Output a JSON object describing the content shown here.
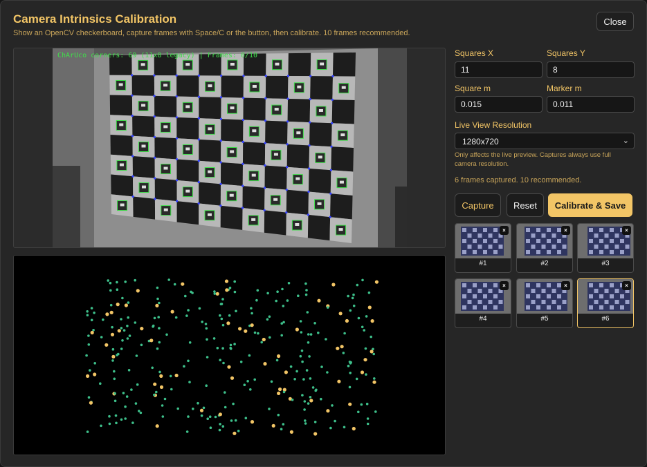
{
  "dialog": {
    "title": "Camera Intrinsics Calibration",
    "subtitle": "Show an OpenCV checkerboard, capture frames with Space/C or the button, then calibrate. 10 frames recommended.",
    "close_label": "Close"
  },
  "camera": {
    "overlay_text": "ChArUco corners: 69 (11x8 legacy) | Frames: 0/10"
  },
  "settings": {
    "squares_x": {
      "label": "Squares X",
      "value": "11"
    },
    "squares_y": {
      "label": "Squares Y",
      "value": "8"
    },
    "square_m": {
      "label": "Square m",
      "value": "0.015"
    },
    "marker_m": {
      "label": "Marker m",
      "value": "0.011"
    },
    "resolution": {
      "label": "Live View Resolution",
      "value": "1280x720",
      "hint": "Only affects the live preview. Captures always use full camera resolution."
    },
    "status": "6 frames captured. 10 recommended."
  },
  "actions": {
    "capture_label": "Capture",
    "reset_label": "Reset",
    "calibrate_label": "Calibrate & Save"
  },
  "thumbnails": [
    {
      "label": "#1",
      "remove": "×"
    },
    {
      "label": "#2",
      "remove": "×"
    },
    {
      "label": "#3",
      "remove": "×"
    },
    {
      "label": "#4",
      "remove": "×"
    },
    {
      "label": "#5",
      "remove": "×"
    },
    {
      "label": "#6",
      "remove": "×"
    }
  ],
  "colors": {
    "accent": "#f2c566",
    "point_green": "#3dbf8a",
    "point_orange": "#f2c566",
    "overlay_green": "#3fe04a",
    "marker_blue": "#3340ff"
  }
}
